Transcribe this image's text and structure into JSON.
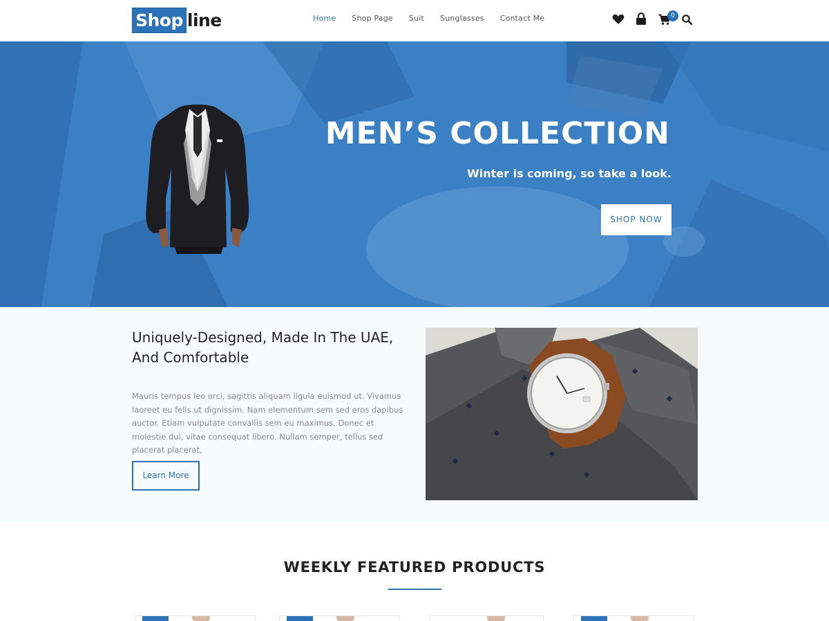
{
  "header": {
    "logo_highlight": "Shop",
    "logo_rest": "line",
    "nav": [
      {
        "label": "Home",
        "active": true
      },
      {
        "label": "Shop Page",
        "active": false
      },
      {
        "label": "Suit",
        "active": false
      },
      {
        "label": "Sunglasses",
        "active": false
      },
      {
        "label": "Contact Me",
        "active": false
      }
    ],
    "icons": [
      "heart-icon",
      "lock-icon",
      "cart-icon",
      "search-icon"
    ],
    "cart_count": "0"
  },
  "hero": {
    "title": "MEN’S COLLECTION",
    "subtitle": "Winter is coming, so take a look.",
    "button": "SHOP NOW"
  },
  "about": {
    "title": "Uniquely-Designed, Made In The UAE, And Comfortable",
    "text": "Mauris tempus leo orci, sagittis aliquam ligula euismod ut. Vivamus laoreet eu felis ut dignissim. Nam elementum sem sed eros dapibus auctor. Etiam vulputate convallis sem eu maximus. Donec et molestie dui, vitae consequat libero. Nullam semper, tellus sed placerat placerat,",
    "button": "Learn More"
  },
  "featured": {
    "title": "WEEKLY FEATURED PRODUCTS"
  },
  "colors": {
    "accent": "#2c72b8",
    "hero_bg": "#3a7ec4",
    "section_bg": "#f6fbfd"
  }
}
